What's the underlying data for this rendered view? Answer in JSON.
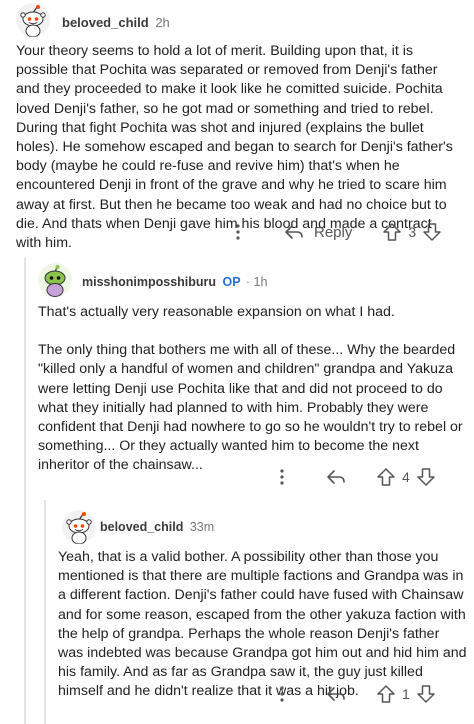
{
  "comments": [
    {
      "username": "beloved_child",
      "age": "2h",
      "body": [
        "Your theory seems to hold a lot of merit. Building upon that, it is possible that Pochita was separated or removed from Denji's father and they proceeded to make it look like he comitted suicide. Pochita loved Denji's father, so he got mad or something and tried to rebel. During that fight Pochita was shot and injured (explains the bullet holes). He somehow escaped and began to search for Denji's father's body (maybe he could re-fuse and revive him) that's when he encountered Denji in front of the grave and why he tried to scare him away at first. But then he became too weak and had no choice but to die. And thats when Denji gave him his blood and made a contract with him."
      ],
      "reply_label": "Reply",
      "votes": "3"
    },
    {
      "username": "misshonimposshiburu",
      "op_badge": "OP",
      "separator": "·",
      "age": "1h",
      "body": [
        "That's actually very reasonable expansion on what I had.",
        "The only thing that bothers me with all of these... Why the bearded \"killed only a handful of women and children\" grandpa and Yakuza were letting Denji use Pochita like that and did not proceed to do what they initially had planned to with him. Probably they were confident that Denji had nowhere to go so he wouldn't try to rebel or something... Or they actually wanted him to become the next inheritor of the chainsaw..."
      ],
      "votes": "4"
    },
    {
      "username": "beloved_child",
      "age": "33m",
      "body": [
        "Yeah, that is a valid bother. A possibility other than those you mentioned is that there are multiple factions and Grandpa was in a different faction. Denji's father could have fused with Chainsaw and for some reason, escaped from the other yakuza faction with the help of grandpa. Perhaps the whole reason Denji's father was indebted was because Grandpa got him out and hid him and his family. And as far as Grandpa saw it, the guy just killed himself and he didn't realize that it was a hit job."
      ],
      "votes": "1"
    }
  ],
  "colors": {
    "text": "#222222",
    "username": "#3a3a3a",
    "op": "#2a6fd6",
    "icon": "#555555",
    "avatar_green": "#8bc34a",
    "snoo_eye": "#ff4500"
  }
}
